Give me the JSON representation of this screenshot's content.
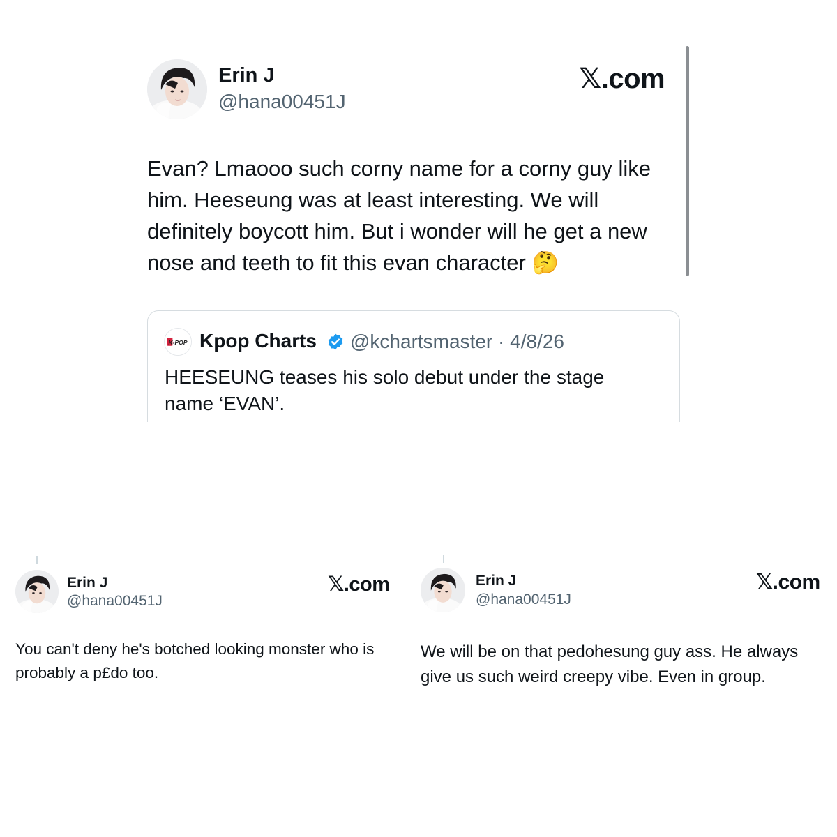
{
  "top_tweet": {
    "name": "Erin J",
    "handle": "@hana00451J",
    "brand": "X.com",
    "brand_mark": "𝕏",
    "brand_suffix": ".com",
    "text": "Evan? Lmaooo such corny name for a corny guy like him. Heeseung was at least interesting. We will definitely boycott him. But i wonder will he get a new nose and teeth to fit this evan character 🤔",
    "quote": {
      "logo_text": "K-POP",
      "name": "Kpop Charts",
      "verified": true,
      "meta": "@kchartsmaster · 4/8/26",
      "text": "HEESEUNG teases his solo debut under the stage name ‘EVAN’."
    }
  },
  "bottom_left_tweet": {
    "name": "Erin J",
    "handle": "@hana00451J",
    "brand_mark": "𝕏",
    "brand_suffix": ".com",
    "text": "You can't deny he's botched looking monster who is probably a p£do too."
  },
  "bottom_right_tweet": {
    "name": "Erin J",
    "handle": "@hana00451J",
    "brand_mark": "𝕏",
    "brand_suffix": ".com",
    "text": "We will be on that pedohesung guy ass. He always give us such weird creepy vibe. Even in group."
  },
  "colors": {
    "text": "#0f1419",
    "secondary": "#536471",
    "verified": "#1d9bf0",
    "border": "#d6dce0"
  },
  "icons": [
    "avatar",
    "verified-badge-icon",
    "kpop-logo-icon",
    "x-logo"
  ]
}
